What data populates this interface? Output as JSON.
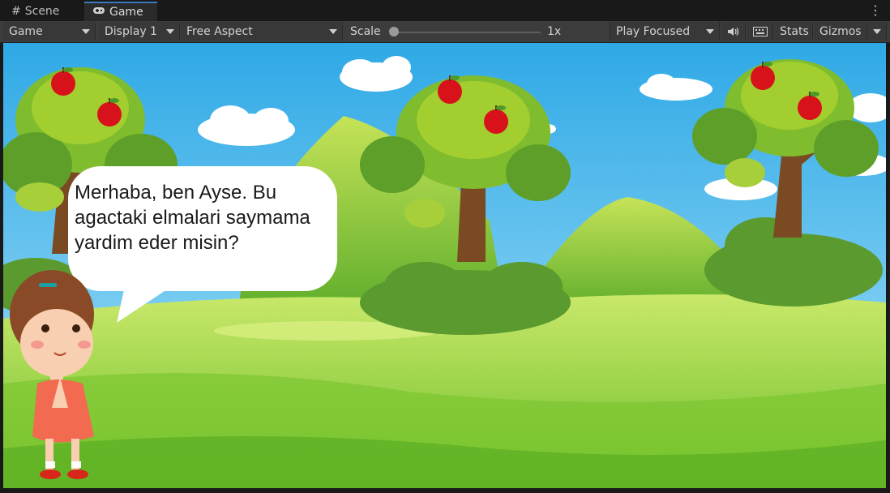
{
  "tabs": [
    {
      "label": "Scene",
      "icon": "grid-icon"
    },
    {
      "label": "Game",
      "icon": "gamepad-icon"
    }
  ],
  "toolbar": {
    "mode": "Game",
    "display": "Display 1",
    "aspect": "Free Aspect",
    "scale_label": "Scale",
    "scale_value": "1x",
    "play_mode": "Play Focused",
    "stats": "Stats",
    "gizmos": "Gizmos"
  },
  "game": {
    "speech": "Merhaba, ben Ayse. Bu agactaki elmalari saymama yardim eder misin?"
  },
  "colors": {
    "sky": "#48b9ec",
    "grass": "#9fd63a",
    "apple": "#d8121a",
    "dress": "#f26a4f"
  }
}
